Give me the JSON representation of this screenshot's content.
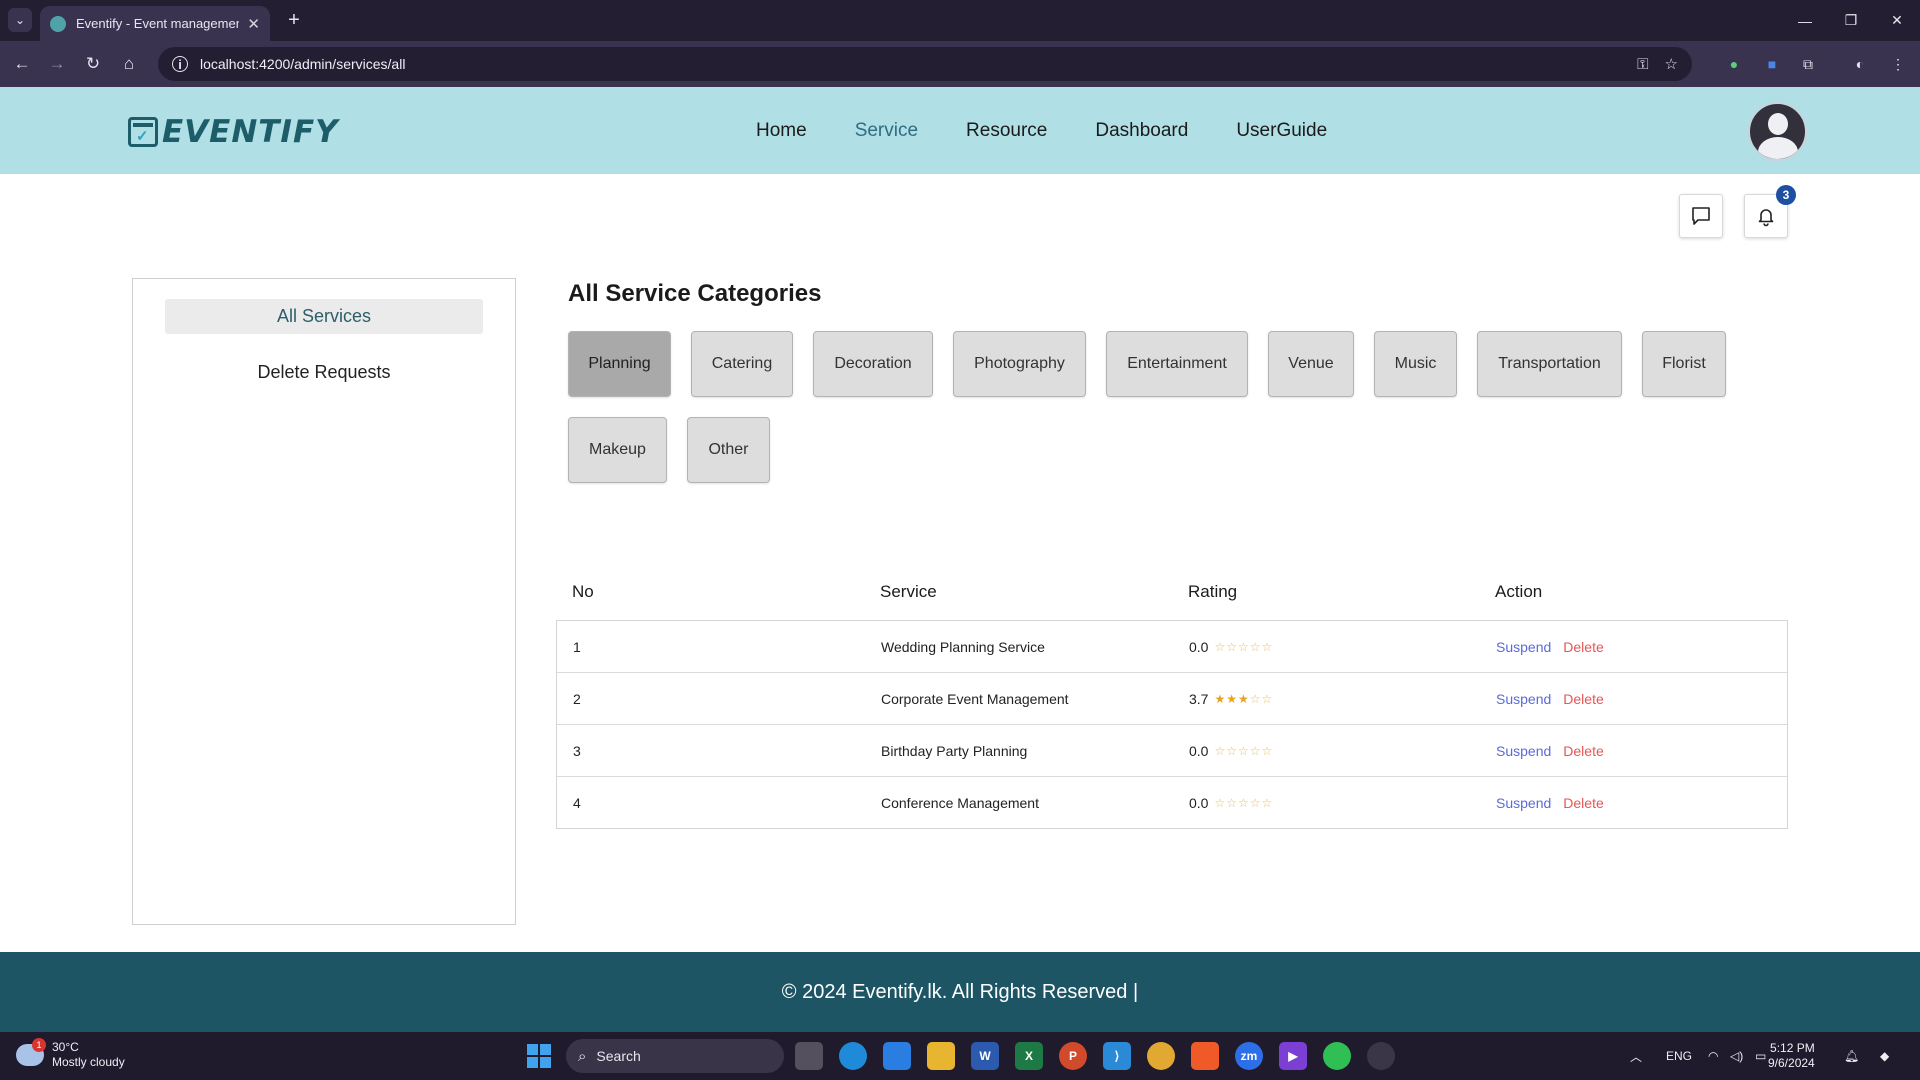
{
  "browser": {
    "tab_title": "Eventify - Event management sy",
    "url": "localhost:4200/admin/services/all"
  },
  "header": {
    "logo_text": "EVENTIFY",
    "nav": [
      {
        "label": "Home",
        "active": false
      },
      {
        "label": "Service",
        "active": true
      },
      {
        "label": "Resource",
        "active": false
      },
      {
        "label": "Dashboard",
        "active": false
      },
      {
        "label": "UserGuide",
        "active": false
      }
    ],
    "notification_count": "3"
  },
  "sidebar": {
    "items": [
      {
        "label": "All Services",
        "active": true
      },
      {
        "label": "Delete Requests",
        "active": false
      }
    ]
  },
  "main": {
    "title": "All Service Categories",
    "categories": [
      {
        "label": "Planning",
        "active": true
      },
      {
        "label": "Catering",
        "active": false
      },
      {
        "label": "Decoration",
        "active": false
      },
      {
        "label": "Photography",
        "active": false
      },
      {
        "label": "Entertainment",
        "active": false
      },
      {
        "label": "Venue",
        "active": false
      },
      {
        "label": "Music",
        "active": false
      },
      {
        "label": "Transportation",
        "active": false
      },
      {
        "label": "Florist",
        "active": false
      },
      {
        "label": "Makeup",
        "active": false
      },
      {
        "label": "Other",
        "active": false
      }
    ],
    "table": {
      "headers": [
        "No",
        "Service",
        "Rating",
        "Action"
      ],
      "rows": [
        {
          "no": "1",
          "service": "Wedding Planning Service",
          "rating": "0.0",
          "stars_filled": 0
        },
        {
          "no": "2",
          "service": "Corporate Event Management",
          "rating": "3.7",
          "stars_filled": 3
        },
        {
          "no": "3",
          "service": "Birthday Party Planning",
          "rating": "0.0",
          "stars_filled": 0
        },
        {
          "no": "4",
          "service": "Conference Management",
          "rating": "0.0",
          "stars_filled": 0
        }
      ],
      "action_suspend": "Suspend",
      "action_delete": "Delete"
    }
  },
  "footer": {
    "text": "© 2024 Eventify.lk. All Rights Reserved |"
  },
  "taskbar": {
    "weather_temp": "30°C",
    "weather_desc": "Mostly cloudy",
    "weather_badge": "1",
    "search_label": "Search",
    "language": "ENG",
    "time": "5:12 PM",
    "date": "9/6/2024"
  },
  "colors": {
    "header_bg": "#b0dfe6",
    "footer_bg": "#1d5564",
    "brand": "#1d5c69",
    "active_nav": "#2f6d80",
    "suspend": "#5b6ad9",
    "delete": "#e55656",
    "star": "#e6a417"
  }
}
